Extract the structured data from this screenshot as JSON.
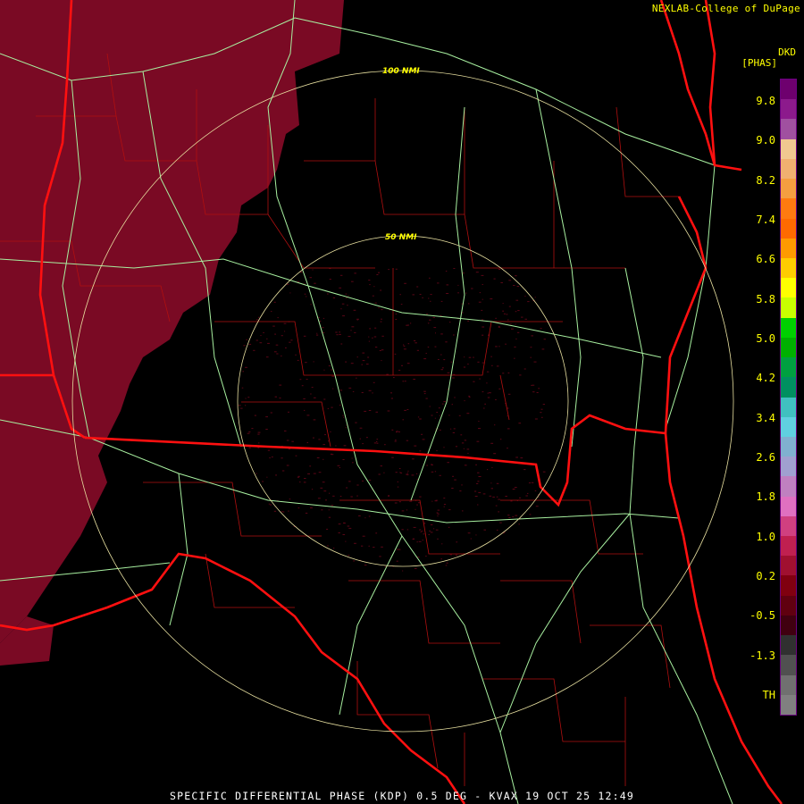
{
  "header": {
    "credit": "NEXLAB-College of DuPage"
  },
  "legend": {
    "product": "DKD",
    "units": "[PHAS]",
    "labels": [
      "9.8",
      "9.0",
      "8.2",
      "7.4",
      "6.6",
      "5.8",
      "5.0",
      "4.2",
      "3.4",
      "2.6",
      "1.8",
      "1.0",
      "0.2",
      "-0.5",
      "-1.3",
      "TH"
    ],
    "colors": [
      "#6e006e",
      "#8c1a8c",
      "#a050a0",
      "#f0c890",
      "#f0b070",
      "#f59e40",
      "#ff7a10",
      "#ff6a00",
      "#ff9a00",
      "#ffcc00",
      "#ffff00",
      "#c8ff00",
      "#00d000",
      "#00b000",
      "#00a040",
      "#009060",
      "#40c0c0",
      "#60d0e0",
      "#80b0d0",
      "#a0a0d0",
      "#c080c0",
      "#e070c0",
      "#d04080",
      "#c02050",
      "#a01030",
      "#800010",
      "#600010",
      "#400010",
      "#303030",
      "#505050",
      "#707070",
      "#808080"
    ]
  },
  "range_rings": {
    "outer_label": "100 NMI",
    "inner_label": "50 NMI"
  },
  "footer": {
    "caption": "SPECIFIC DIFFERENTIAL PHASE (KDP) 0.5 DEG - KVAX 19 OCT 25 12:49"
  },
  "map_colors": {
    "background": "#000000",
    "precip": "#7a0a24",
    "precip_light": "#5a0616",
    "state_border": "#ff1010",
    "county": "#b01010",
    "highway": "#a8f0a0",
    "road": "#e8e860",
    "ring": "#e8e0a0"
  }
}
